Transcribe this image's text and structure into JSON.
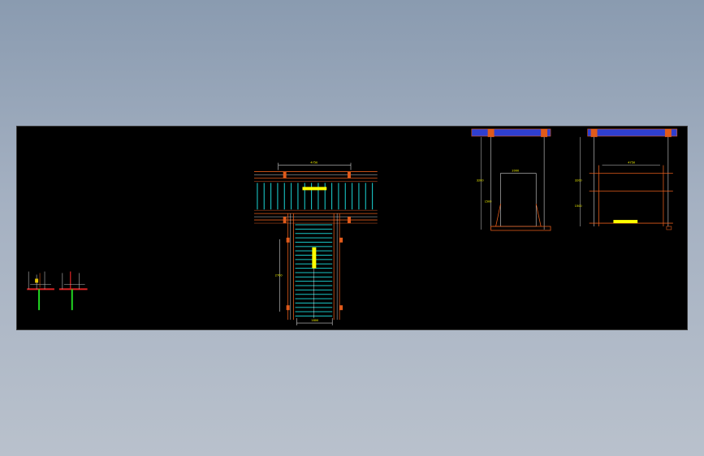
{
  "drawing": {
    "colors": {
      "background": "#000000",
      "frame_outer": "#e05a1a",
      "frame_inner": "#a8451c",
      "slat": "#19c6c6",
      "steel": "#c8662a",
      "dim": "#ffffff",
      "text": "#ffff00",
      "hatch": "#2f3fd0",
      "green": "#22d822",
      "red": "#e02424"
    },
    "dim_labels": {
      "top_width": "4750",
      "stair_width": "1800",
      "side_left": "2700",
      "section_a_height": "3200",
      "section_a_lower": "1500",
      "section_a_width": "2000",
      "section_b_height": "3200",
      "section_b_lower": "1500",
      "section_b_width": "4750"
    }
  }
}
